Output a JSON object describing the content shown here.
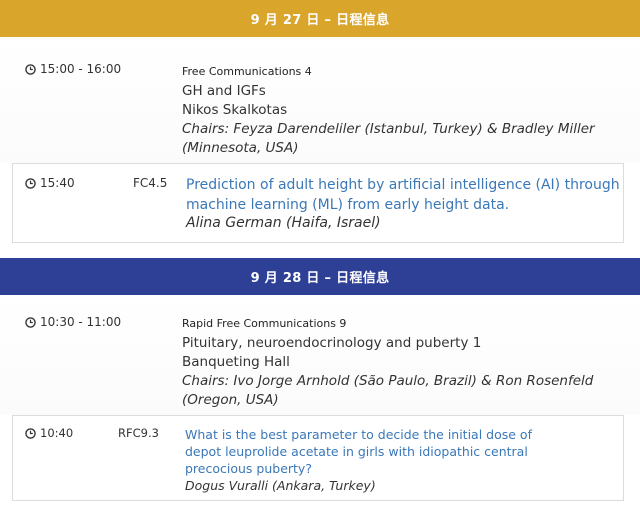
{
  "days": [
    {
      "header": "9 月 27 日 – 日程信息",
      "session": {
        "time": "15:00 - 16:00",
        "type": "Free Communications 4",
        "topic": "GH and IGFs",
        "room": "Nikos Skalkotas",
        "chairs_line1": "Chairs: Feyza Darendeliler (Istanbul, Turkey) & Bradley Miller",
        "chairs_line2": "(Minnesota, USA)"
      },
      "presentation": {
        "time": "15:40",
        "code": "FC4.5",
        "title_line1": "Prediction of adult height by artificial intelligence (AI) through",
        "title_line2": "machine learning (ML) from early height data.",
        "author": "Alina German (Haifa, Israel)"
      }
    },
    {
      "header": "9 月 28 日 – 日程信息",
      "session": {
        "time": "10:30 - 11:00",
        "type": "Rapid Free Communications 9",
        "topic": "Pituitary, neuroendocrinology and puberty 1",
        "room": "Banqueting Hall",
        "chairs_line1": "Chairs: Ivo Jorge Arnhold (São Paulo, Brazil) & Ron Rosenfeld",
        "chairs_line2": "(Oregon, USA)"
      },
      "presentation": {
        "time": "10:40",
        "code": "RFC9.3",
        "title_line1": "What is the best parameter to decide the initial dose of",
        "title_line2": "depot leuprolide acetate in girls with idiopathic central",
        "title_line3": "precocious puberty?",
        "author": "Dogus Vuralli (Ankara, Turkey)"
      }
    }
  ],
  "colors": {
    "day1": "#d9a52b",
    "day2": "#2e3f96",
    "link": "#3a78b8"
  },
  "icons": {
    "time": "clock-icon"
  }
}
